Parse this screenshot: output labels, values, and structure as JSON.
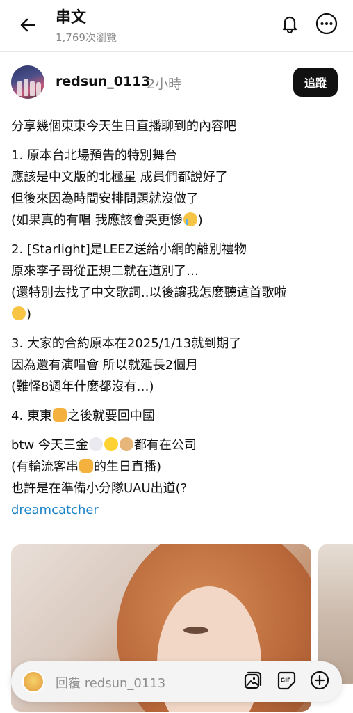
{
  "header": {
    "title": "串文",
    "views": "1,769次瀏覽",
    "icons": {
      "back": "arrow-left-icon",
      "bell": "bell-icon",
      "more": "more-horizontal-icon"
    }
  },
  "author": {
    "username": "redsun_0113",
    "time": "2小時",
    "follow_label": "追蹤"
  },
  "post": {
    "intro": "分享幾個東東今天生日直播聊到的內容吧",
    "p1": {
      "l1": "1. 原本台北場預告的特別舞台",
      "l2": "應該是中文版的北極星 成員們都說好了",
      "l3": "但後來因為時間安排問題就沒做了",
      "l4": "(如果真的有唱 我應該會哭更慘"
    },
    "p1_close": ")",
    "p2": {
      "l1": "2. [Starlight]是LEEZ送給小網的離別禮物",
      "l2": "原來李子哥從正規二就在道別了…",
      "l3": "(還特別去找了中文歌詞..以後讓我怎麼聽這首歌啦",
      "l4_close": ")"
    },
    "p3": {
      "l1": "3. 大家的合約原本在2025/1/13就到期了",
      "l2": "因為還有演唱會 所以就延長2個月",
      "l3": "(難怪8週年什麼都沒有…)"
    },
    "p4": {
      "l1a": "4. 東東",
      "l1b": "之後就要回中國"
    },
    "p5": {
      "l1a": "btw 今天三金",
      "l1b": "都有在公司",
      "l2a": "(有輪流客串",
      "l2b": "的生日直播)",
      "l3": "也許是在準備小分隊UAU出道(?"
    },
    "hashtag": "dreamcatcher"
  },
  "reply": {
    "placeholder": "回覆 redsun_0113",
    "icons": {
      "image": "image-icon",
      "gif": "gif-icon",
      "add": "plus-circle-icon"
    }
  },
  "colors": {
    "hashtag": "#1d83c8",
    "follow_bg": "#111111",
    "muted": "#8a8a8a"
  }
}
